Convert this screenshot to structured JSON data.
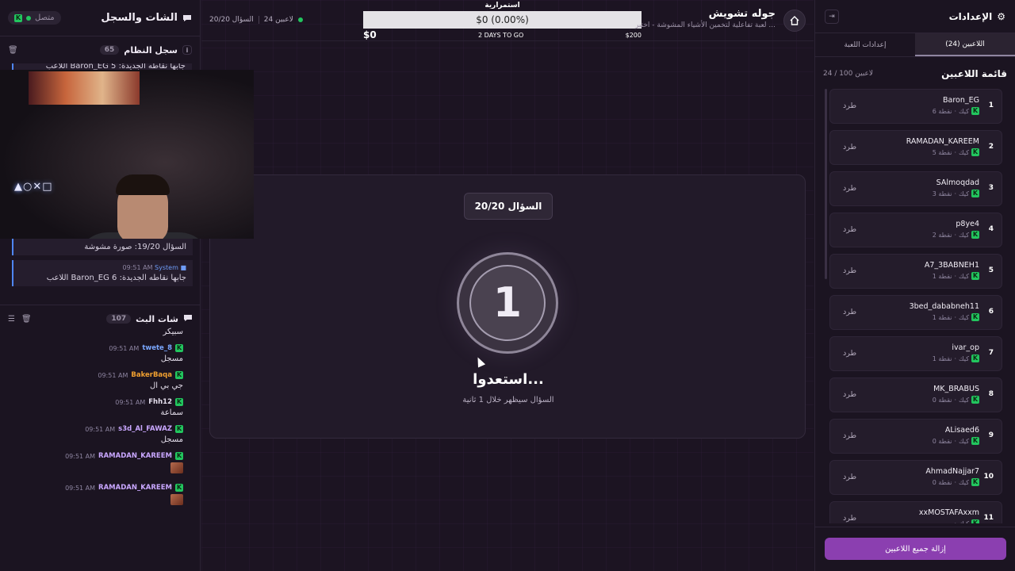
{
  "left": {
    "title": "الشات والسجل",
    "status": "متصل",
    "syslog": {
      "title": "سجل النظام",
      "count": "65",
      "peek_text": "اللاعب Baron_EG جابها نقاطه الجديدة: 5",
      "items": [
        {
          "sender": "",
          "time": "",
          "text": "السؤال 19/20: صورة مشوشة"
        },
        {
          "sender": "System",
          "time": "09:51 AM",
          "text": "اللاعب Baron_EG جابها نقاطه الجديدة: 6"
        }
      ]
    },
    "chat": {
      "title": "شات البث",
      "count": "107",
      "top_msg": "سبيكر",
      "items": [
        {
          "user": "twete_8",
          "time": "09:51 AM",
          "text": "مسجل",
          "color": "#7aa7ff",
          "emote": false
        },
        {
          "user": "BakerBaqa",
          "time": "09:51 AM",
          "text": "جي بي ال",
          "color": "#f0a030",
          "emote": false
        },
        {
          "user": "Fhh12",
          "time": "09:51 AM",
          "text": "سماعة",
          "color": "#e6e0ee",
          "emote": false
        },
        {
          "user": "s3d_Al_FAWAZ",
          "time": "09:51 AM",
          "text": "مسجل",
          "color": "#c9a7ff",
          "emote": false
        },
        {
          "user": "RAMADAN_KAREEM",
          "time": "09:51 AM",
          "text": "",
          "color": "#c9a7ff",
          "emote": true
        },
        {
          "user": "RAMADAN_KAREEM",
          "time": "09:51 AM",
          "text": "",
          "color": "#c9a7ff",
          "emote": true
        }
      ]
    }
  },
  "topbar": {
    "game_name": "جوله تشويش",
    "game_desc": "لعبة تفاعلية لتخمين الأشياء المشوشة - اختبر ...",
    "players_online": "24 لاعبين",
    "question_progress": "السؤال 20/20",
    "donation_label": "استمرارية",
    "donation_value": "$0 (0.00%)",
    "donation_current": "$0",
    "donation_days": "2 DAYS TO GO",
    "donation_goal": "$200"
  },
  "card": {
    "question_badge": "السؤال 20/20",
    "countdown": "1",
    "ready_title": "استعدوا...",
    "ready_sub": "السؤال سيظهر خلال 1 ثانية"
  },
  "right": {
    "title": "الإعدادات",
    "tabs": [
      "اللاعبين (24)",
      "إعدادات اللعبة"
    ],
    "list_title": "قائمة اللاعبين",
    "list_count": "24 / 100 لاعبين",
    "kick_label": "طرد",
    "platform_label": "كيك",
    "players": [
      {
        "rank": "1",
        "name": "Baron_EG",
        "points": "6 نقطة"
      },
      {
        "rank": "2",
        "name": "RAMADAN_KAREEM",
        "points": "5 نقطة"
      },
      {
        "rank": "3",
        "name": "SAlmoqdad",
        "points": "3 نقطة"
      },
      {
        "rank": "4",
        "name": "p8ye4",
        "points": "2 نقطة"
      },
      {
        "rank": "5",
        "name": "A7_3BABNEH1",
        "points": "1 نقطة"
      },
      {
        "rank": "6",
        "name": "3bed_dababneh11",
        "points": "1 نقطة"
      },
      {
        "rank": "7",
        "name": "ivar_op",
        "points": "1 نقطة"
      },
      {
        "rank": "8",
        "name": "MK_BRABUS",
        "points": "0 نقطة"
      },
      {
        "rank": "9",
        "name": "ALisaed6",
        "points": "0 نقطة"
      },
      {
        "rank": "10",
        "name": "AhmadNajjar7",
        "points": "0 نقطة"
      },
      {
        "rank": "11",
        "name": "xxMOSTAFAxxm",
        "points": ""
      }
    ],
    "remove_all": "إزالة جميع اللاعبين"
  },
  "colors": {
    "accent": "#8b3fb0",
    "online": "#22c55e",
    "system": "#4f86f7"
  }
}
